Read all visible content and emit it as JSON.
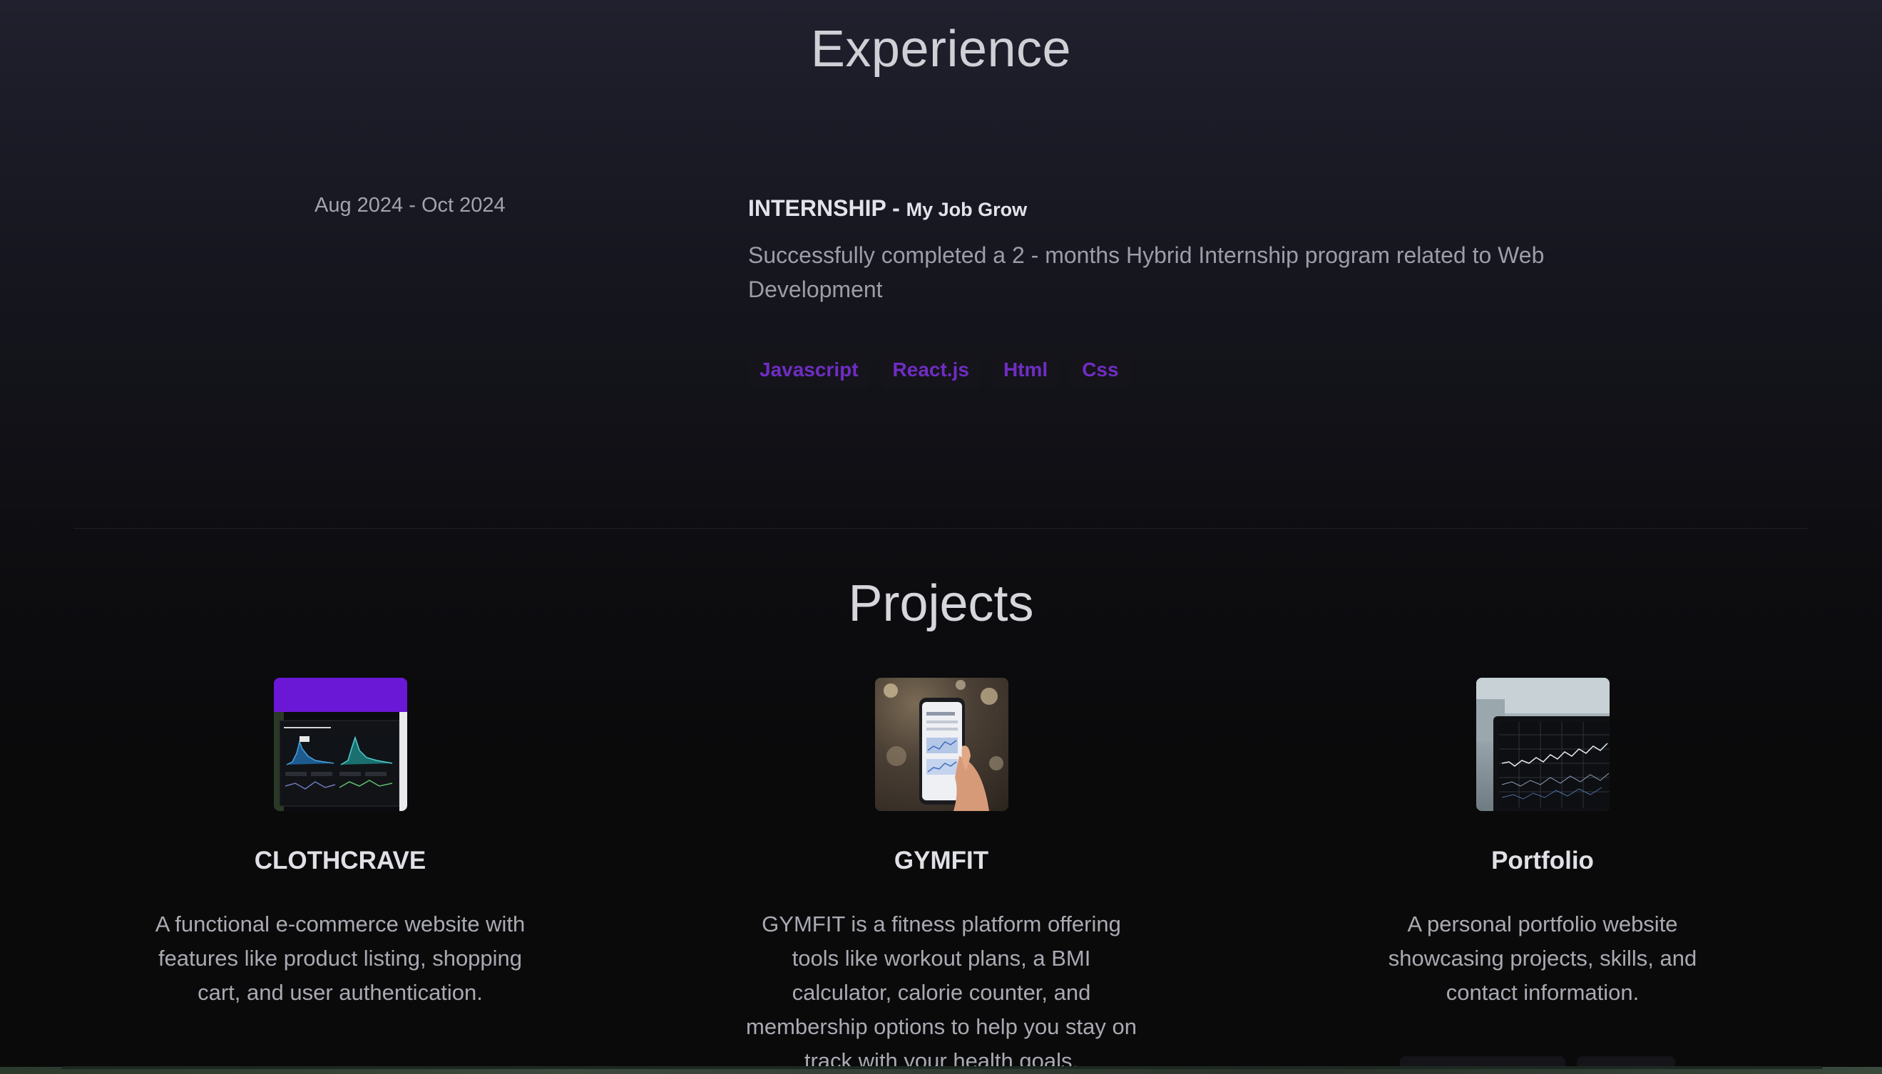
{
  "experience": {
    "title": "Experience",
    "date": "Aug 2024 - Oct 2024",
    "role": "INTERNSHIP",
    "separator": " - ",
    "company": "My Job Grow",
    "description": "Successfully completed a 2 - months Hybrid Internship program related to Web Development",
    "tags": [
      "Javascript",
      "React.js",
      "Html",
      "Css"
    ]
  },
  "projects": {
    "title": "Projects",
    "items": [
      {
        "name": "CLOTHCRAVE",
        "description": "A functional e-commerce website with features like product listing, shopping cart, and user authentication.",
        "image_icon": "dashboard-charts-thumbnail"
      },
      {
        "name": "GYMFIT",
        "description": "GYMFIT is a fitness platform offering tools like workout plans, a BMI calculator, calorie counter, and membership options to help you stay on track with your health goals.",
        "image_icon": "phone-in-hand-thumbnail"
      },
      {
        "name": "Portfolio",
        "description": "A personal portfolio website showcasing projects, skills, and contact information.",
        "image_icon": "laptop-stock-chart-thumbnail"
      }
    ]
  },
  "colors": {
    "accent": "#6f2dc3",
    "tag_bg": "#15141b",
    "heading": "#d6d7dc",
    "body_text": "#a9aab2"
  }
}
